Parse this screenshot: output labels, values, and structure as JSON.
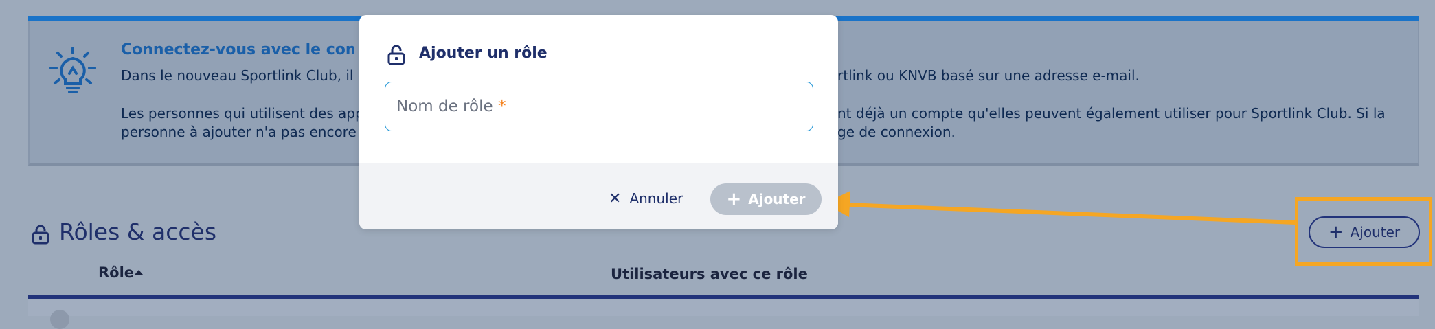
{
  "info": {
    "title": "Connectez-vous avec le compte",
    "line1_left": "Dans le nouveau Sportlink Club, il es",
    "line1_right": "rtlink ou KNVB basé sur une adresse e-mail.",
    "line2_left": "Les personnes qui utilisent des appl",
    "line2_right": "nt déjà un compte qu'elles peuvent également utiliser pour Sportlink Club. Si la",
    "line3_left": "personne à ajouter n'a pas encore c",
    "line3_right": "ge de connexion.",
    "icon": "lightbulb-icon"
  },
  "section": {
    "title": "Rôles & accès",
    "add_label": "Ajouter",
    "columns": [
      "Rôle",
      "Utilisateurs avec ce rôle"
    ]
  },
  "modal": {
    "title": "Ajouter un rôle",
    "input_label": "Nom de rôle",
    "required_marker": "*",
    "cancel_label": "Annuler",
    "add_label": "Ajouter"
  },
  "colors": {
    "accent": "#1a73c8",
    "navy": "#1f2f6a",
    "highlight": "#f5a623",
    "input_focus": "#2196d6"
  }
}
